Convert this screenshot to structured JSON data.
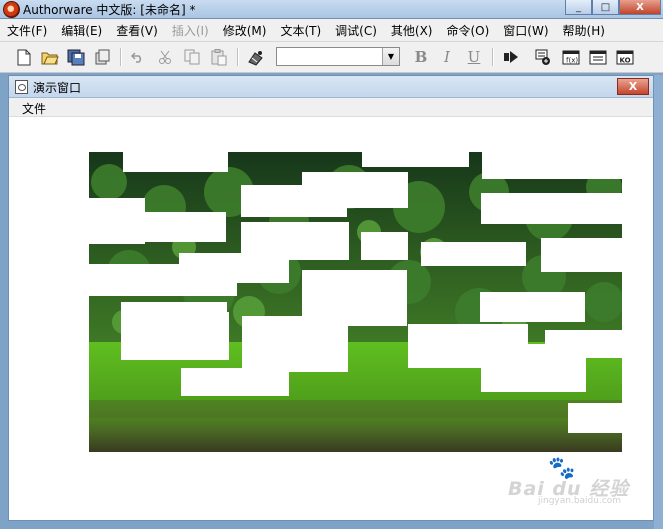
{
  "app": {
    "title": "Authorware 中文版: [未命名] *",
    "window_buttons": {
      "minimize": "_",
      "maximize": "□",
      "close": "X"
    }
  },
  "menubar": {
    "items": [
      {
        "label": "文件(F)",
        "enabled": true
      },
      {
        "label": "编辑(E)",
        "enabled": true
      },
      {
        "label": "查看(V)",
        "enabled": true
      },
      {
        "label": "插入(I)",
        "enabled": false
      },
      {
        "label": "修改(M)",
        "enabled": true
      },
      {
        "label": "文本(T)",
        "enabled": true
      },
      {
        "label": "调试(C)",
        "enabled": true
      },
      {
        "label": "其他(X)",
        "enabled": true
      },
      {
        "label": "命令(O)",
        "enabled": true
      },
      {
        "label": "窗口(W)",
        "enabled": true
      },
      {
        "label": "帮助(H)",
        "enabled": true
      }
    ]
  },
  "toolbar": {
    "icons": [
      "new-file-icon",
      "open-folder-icon",
      "save-all-icon",
      "import-icon",
      "undo-icon",
      "cut-icon",
      "copy-icon",
      "paste-icon",
      "find-icon",
      "run-icon",
      "control-panel-icon",
      "functions-icon",
      "variables-icon",
      "knowledge-objects-icon"
    ],
    "font_value": "",
    "bold": "B",
    "italic": "I",
    "underline": "U"
  },
  "presentation_window": {
    "title": "演示窗口",
    "close_label": "X",
    "menu": {
      "file": "文件"
    }
  },
  "watermark": {
    "brand": "Bai du 经验",
    "url": "jingyan.baidu.com"
  },
  "colors": {
    "titlebar": "#c3d6ec",
    "forest_dark": "#1f4a1a",
    "meadow": "#5fb322",
    "close_red": "#c4452c"
  }
}
